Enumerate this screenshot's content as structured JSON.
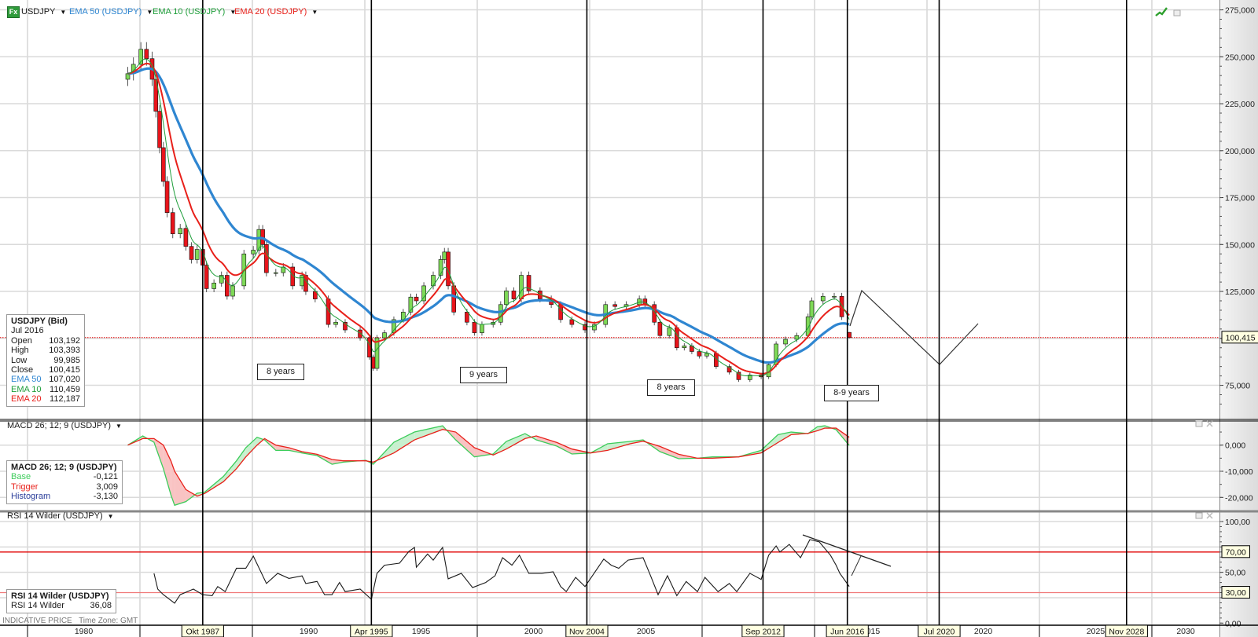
{
  "toolbar": {
    "fx_badge": "Fx",
    "instrument": "USDJPY",
    "ema50": "EMA 50 (USDJPY)",
    "ema10": "EMA 10 (USDJPY)",
    "ema20": "EMA 20 (USDJPY)"
  },
  "colors": {
    "candle_up": "#7ed957",
    "candle_down": "#e8141b",
    "ema50": "#2f86d1",
    "ema10": "#1e9e3a",
    "ema20": "#e8201a",
    "macd_base": "#3ccc5a",
    "macd_trigger": "#e8201a",
    "macd_histogram": "#2a3d9a",
    "rsi_line": "#1a1a1a",
    "rsi_overbought": "#e00000",
    "rsi_oversold": "#f07878",
    "last_price_line": "#e00000",
    "label_box": "#ffffe1"
  },
  "info_box": {
    "title": "USDJPY (Bid)",
    "period": "Jul 2016",
    "rows": [
      {
        "label": "Open",
        "value": "103,192"
      },
      {
        "label": "High",
        "value": "103,393"
      },
      {
        "label": "Low",
        "value": "99,985"
      },
      {
        "label": "Close",
        "value": "100,415"
      },
      {
        "label": "EMA 50",
        "value": "107,020"
      },
      {
        "label": "EMA 10",
        "value": "110,459"
      },
      {
        "label": "EMA 20",
        "value": "112,187"
      }
    ]
  },
  "macd": {
    "legend": "MACD 26; 12; 9 (USDJPY)",
    "box_title": "MACD 26; 12; 9 (USDJPY)",
    "rows": [
      {
        "label": "Base",
        "value": "-0,121"
      },
      {
        "label": "Trigger",
        "value": "3,009"
      },
      {
        "label": "Histogram",
        "value": "-3,130"
      }
    ]
  },
  "rsi": {
    "legend": "RSI 14 Wilder (USDJPY)",
    "box_title": "RSI 14 Wilder (USDJPY)",
    "row_label": "RSI 14 Wilder",
    "row_value": "36,08"
  },
  "footer": {
    "indicative": "INDICATIVE PRICE",
    "timezone": "Time Zone: GMT"
  },
  "annotations": {
    "cycle_boxes": [
      "8 years",
      "9 years",
      "8 years",
      "8-9 years"
    ]
  },
  "chart_data": [
    {
      "panel": "price",
      "type": "candlestick",
      "instrument": "USDJPY",
      "interval": "monthly",
      "last_price_label": "100,415",
      "last_price": 100.415,
      "ylim": [
        62,
        280
      ],
      "grid": true,
      "y_ticks": [
        {
          "value": 275,
          "label": "275,000"
        },
        {
          "value": 250,
          "label": "250,000"
        },
        {
          "value": 225,
          "label": "225,000"
        },
        {
          "value": 200,
          "label": "200,000"
        },
        {
          "value": 175,
          "label": "175,000"
        },
        {
          "value": 150,
          "label": "150,000"
        },
        {
          "value": 125,
          "label": "125,000"
        },
        {
          "value": 100,
          "label": "100,000"
        },
        {
          "value": 75,
          "label": "75,000"
        }
      ],
      "last_bar": {
        "date": "2016-07",
        "open": 103.192,
        "high": 103.393,
        "low": 99.985,
        "close": 100.415
      },
      "dates": [
        "1984-06",
        "1984-09",
        "1985-01",
        "1985-04",
        "1985-07",
        "1985-09",
        "1985-11",
        "1986-01",
        "1986-03",
        "1986-06",
        "1986-10",
        "1987-01",
        "1987-04",
        "1987-07",
        "1987-10",
        "1987-12",
        "1988-04",
        "1988-08",
        "1988-11",
        "1989-02",
        "1989-08",
        "1990-01",
        "1990-04",
        "1990-06",
        "1990-08",
        "1991-01",
        "1991-05",
        "1991-10",
        "1992-03",
        "1992-05",
        "1992-10",
        "1993-05",
        "1993-09",
        "1994-02",
        "1994-10",
        "1995-03",
        "1995-05",
        "1995-07",
        "1995-11",
        "1996-04",
        "1996-09",
        "1997-01",
        "1997-04",
        "1997-08",
        "1998-01",
        "1998-05",
        "1998-07",
        "1998-09",
        "1998-12",
        "1999-07",
        "1999-11",
        "2000-03",
        "2000-09",
        "2001-01",
        "2001-04",
        "2001-08",
        "2001-12",
        "2002-04",
        "2002-10",
        "2003-04",
        "2003-09",
        "2004-03",
        "2004-10",
        "2005-03",
        "2005-09",
        "2006-02",
        "2006-08",
        "2007-03",
        "2007-06",
        "2007-11",
        "2008-02",
        "2008-07",
        "2008-11",
        "2009-03",
        "2009-07",
        "2009-11",
        "2010-03",
        "2010-08",
        "2011-03",
        "2011-08",
        "2012-02",
        "2012-08",
        "2012-12",
        "2013-04",
        "2013-09",
        "2014-03",
        "2014-09",
        "2014-11",
        "2015-05",
        "2015-11",
        "2016-03",
        "2016-07"
      ],
      "close": [
        241,
        246,
        254,
        249,
        238,
        221,
        201.6,
        183.6,
        167,
        155.7,
        158.6,
        149,
        142,
        147.4,
        139,
        126.5,
        129.5,
        133.6,
        122.5,
        128,
        145,
        147,
        158,
        150,
        135,
        135,
        138,
        128,
        133.6,
        125,
        121,
        107.4,
        108.6,
        104.5,
        100.3,
        90,
        84,
        100.3,
        103,
        110,
        114,
        122,
        120,
        128,
        133.6,
        142,
        146,
        128,
        114,
        108.6,
        103,
        107.4,
        108.6,
        118,
        125.3,
        121,
        133.6,
        125.3,
        121,
        118,
        110,
        107.4,
        104.5,
        107.4,
        118,
        117,
        118,
        121,
        118,
        108.6,
        101.5,
        105.7,
        95,
        96,
        93,
        90.6,
        92,
        85,
        82,
        78,
        80.5,
        79.5,
        86,
        97,
        99.5,
        101.5,
        111.5,
        120,
        122.4,
        122.4,
        111.5,
        100.415
      ],
      "indicators": [
        {
          "name": "EMA 50 (USDJPY)",
          "period": 50
        },
        {
          "name": "EMA 10 (USDJPY)",
          "period": 10
        },
        {
          "name": "EMA 20 (USDJPY)",
          "period": 20
        }
      ],
      "cycle_markers": [
        {
          "label": "Okt 1987",
          "date": "1987-10"
        },
        {
          "label": "Apr 1995",
          "date": "1995-04"
        },
        {
          "label": "Nov 2004",
          "date": "2004-11"
        },
        {
          "label": "Sep 2012",
          "date": "2012-09"
        },
        {
          "label": "Jun 2016",
          "date": "2016-06"
        },
        {
          "label": "Jul 2020",
          "date": "2020-07"
        },
        {
          "label": "Nov 2028",
          "date": "2028-11"
        }
      ],
      "x_tick_labels": [
        "1980",
        "1990",
        "1995",
        "2000",
        "2005",
        "2015",
        "2020",
        "2025",
        "2030"
      ]
    },
    {
      "panel": "macd",
      "type": "line",
      "ylim": [
        -25,
        10
      ],
      "y_ticks": [
        {
          "value": 0,
          "label": "0,000"
        },
        {
          "value": -10,
          "label": "-10,000"
        },
        {
          "value": -20,
          "label": "-20,000"
        }
      ],
      "dates": [
        "1984-06",
        "1985-02",
        "1985-08",
        "1986-01",
        "1986-05",
        "1986-07",
        "1987-01",
        "1987-07",
        "1987-11",
        "1988-09",
        "1989-04",
        "1989-09",
        "1990-03",
        "1990-07",
        "1991-01",
        "1991-08",
        "1992-03",
        "1992-11",
        "1993-07",
        "1994-01",
        "1995-01",
        "1995-05",
        "1996-04",
        "1997-03",
        "1998-06",
        "1999-01",
        "1999-11",
        "2000-09",
        "2001-04",
        "2002-02",
        "2002-08",
        "2003-07",
        "2004-03",
        "2005-01",
        "2005-10",
        "2006-10",
        "2007-05",
        "2008-02",
        "2008-12",
        "2009-10",
        "2010-06",
        "2011-08",
        "2012-08",
        "2013-05",
        "2013-12",
        "2014-09",
        "2015-02",
        "2015-06",
        "2015-12",
        "2016-07"
      ],
      "series": [
        {
          "name": "Base",
          "values": [
            0,
            3.5,
            1.1,
            -9,
            -19,
            -23,
            -21.6,
            -18.4,
            -18,
            -12,
            -6,
            -1,
            3,
            2,
            -2,
            -2,
            -3,
            -4,
            -7.3,
            -6.5,
            -5.8,
            -7.3,
            1.1,
            5,
            7.4,
            2,
            -4.5,
            -3.4,
            1.4,
            4.4,
            2,
            -0.4,
            -3.4,
            -3,
            0.5,
            1.4,
            2,
            -2.5,
            -5.2,
            -5,
            -4.5,
            -4.5,
            -2,
            4,
            5,
            4.4,
            7,
            7.4,
            5.9,
            -0.121
          ]
        },
        {
          "name": "Trigger",
          "values": [
            0,
            2.5,
            2.5,
            0,
            -6,
            -10,
            -17,
            -19.5,
            -18.5,
            -14,
            -9,
            -4.5,
            0,
            2.5,
            0,
            -1,
            -2.5,
            -3.5,
            -5.5,
            -6,
            -6,
            -6.5,
            -3,
            2,
            6,
            5,
            -1,
            -3.8,
            -1.5,
            2.5,
            3.5,
            1,
            -1.5,
            -3,
            -2,
            0.5,
            1.5,
            -0.5,
            -3.5,
            -5,
            -5,
            -4.5,
            -3,
            1,
            4,
            4.5,
            5.5,
            6.5,
            6.5,
            3.009
          ]
        }
      ]
    },
    {
      "panel": "rsi",
      "type": "line",
      "ylim": [
        0,
        100
      ],
      "levels": [
        {
          "value": 70,
          "label": "70,00"
        },
        {
          "value": 30,
          "label": "30,00"
        }
      ],
      "y_ticks": [
        {
          "value": 100,
          "label": "100,00"
        },
        {
          "value": 50,
          "label": "50,00"
        },
        {
          "value": 0,
          "label": "0,00"
        }
      ],
      "dates": [
        "1985-08",
        "1985-10",
        "1986-01",
        "1986-07",
        "1986-10",
        "1987-05",
        "1987-10",
        "1988-03",
        "1988-06",
        "1988-10",
        "1989-04",
        "1989-09",
        "1990-01",
        "1990-08",
        "1991-02",
        "1991-08",
        "1992-03",
        "1992-05",
        "1992-11",
        "1993-03",
        "1993-07",
        "1993-11",
        "1994-02",
        "1994-10",
        "1995-04",
        "1995-07",
        "1995-11",
        "1996-07",
        "1996-12",
        "1997-03",
        "1997-04",
        "1997-10",
        "1998-01",
        "1998-06",
        "1998-09",
        "1999-04",
        "1999-10",
        "2000-05",
        "2000-10",
        "2001-02",
        "2001-07",
        "2001-11",
        "2002-04",
        "2002-11",
        "2003-05",
        "2003-09",
        "2003-12",
        "2004-05",
        "2004-10",
        "2005-08",
        "2005-12",
        "2006-04",
        "2006-09",
        "2007-05",
        "2007-09",
        "2008-01",
        "2008-06",
        "2008-11",
        "2009-04",
        "2009-10",
        "2010-02",
        "2010-09",
        "2011-03",
        "2011-07",
        "2012-02",
        "2012-08",
        "2012-12",
        "2013-04",
        "2013-06",
        "2013-11",
        "2014-05",
        "2014-10",
        "2015-03",
        "2015-09",
        "2015-12",
        "2016-02",
        "2016-07"
      ],
      "values": [
        49,
        33.5,
        28,
        19.6,
        28,
        33.5,
        28,
        27,
        36,
        31,
        54,
        54,
        66,
        39,
        49,
        44,
        46.5,
        39,
        41,
        28,
        28,
        40,
        31,
        33.5,
        23.4,
        49,
        57,
        59,
        70.6,
        74.5,
        55,
        68,
        62,
        74.5,
        43.6,
        49,
        35,
        40,
        46.6,
        64.4,
        57,
        66.8,
        49,
        49,
        50.5,
        36,
        31,
        45,
        36,
        63,
        57,
        54,
        62,
        64.4,
        46.6,
        28,
        46.6,
        27,
        41,
        31,
        45,
        31,
        39,
        31,
        49,
        43,
        66.8,
        76,
        70,
        77.5,
        64.4,
        82.2,
        80,
        66.8,
        57,
        49,
        36.08
      ]
    }
  ]
}
